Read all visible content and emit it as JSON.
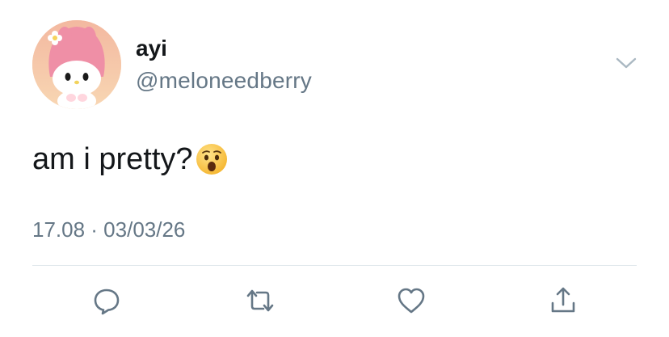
{
  "tweet": {
    "display_name": "ayi",
    "handle": "@meloneedberry",
    "text": "am i pretty?",
    "timestamp": "17.08 · 03/03/26"
  },
  "icons": {
    "menu": "chevron-down-icon",
    "emoji": "astonished-face-emoji",
    "actions": [
      "reply-icon",
      "retweet-icon",
      "like-icon",
      "share-icon"
    ]
  },
  "colors": {
    "text": "#14171a",
    "secondary": "#657786",
    "divider": "#e1e8ed"
  }
}
